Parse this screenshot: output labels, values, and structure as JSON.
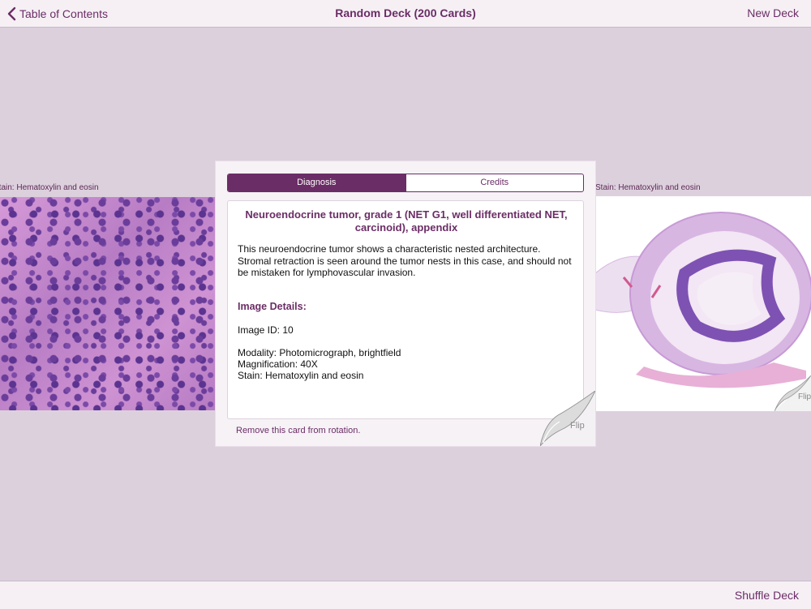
{
  "nav": {
    "back_label": "Table of Contents",
    "title": "Random Deck (200 Cards)",
    "right_label": "New Deck"
  },
  "bottom": {
    "right_label": "Shuffle Deck"
  },
  "left_card": {
    "caption": "Stain: Hematoxylin and eosin"
  },
  "right_card": {
    "caption": "Stain: Hematoxylin and eosin",
    "flip_label": "Flip"
  },
  "card": {
    "tabs": [
      {
        "label": "Diagnosis",
        "active": true
      },
      {
        "label": "Credits",
        "active": false
      }
    ],
    "title": "Neuroendocrine tumor, grade 1 (NET G1, well differentiated NET, carcinoid), appendix",
    "description": "This neuroendocrine tumor shows a characteristic nested architecture. Stromal retraction is seen around the tumor nests in this case, and should not be mistaken for lymphovascular invasion.",
    "details_heading": "Image Details:",
    "image_id": "Image ID: 10",
    "modality": "Modality: Photomicrograph, brightfield",
    "magnification": "Magnification: 40X",
    "stain": "Stain: Hematoxylin and eosin",
    "remove_label": "Remove this card from rotation.",
    "flip_label": "Flip"
  },
  "colors": {
    "accent": "#6b2d66",
    "background": "#ddd0dd",
    "bar": "#f6f0f5"
  }
}
